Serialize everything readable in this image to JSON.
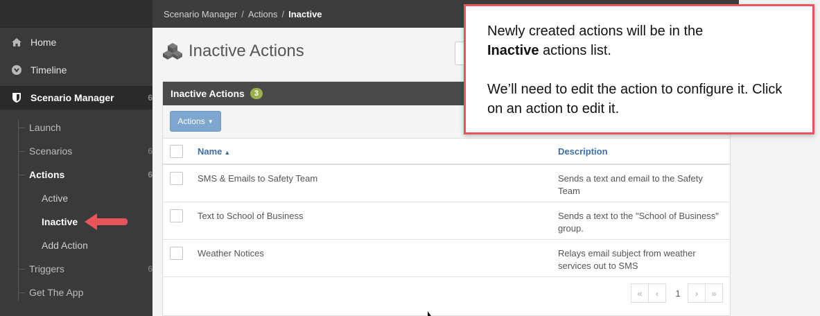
{
  "sidebar": {
    "items": [
      {
        "label": "Home",
        "icon": "home-icon"
      },
      {
        "label": "Timeline",
        "icon": "timeline-icon"
      },
      {
        "label": "Scenario Manager",
        "icon": "shield-icon",
        "trail": "6"
      }
    ],
    "sub_items": [
      {
        "label": "Launch"
      },
      {
        "label": "Scenarios",
        "trail": "6"
      },
      {
        "label": "Actions",
        "trail": "6"
      }
    ],
    "action_items": [
      {
        "label": "Active"
      },
      {
        "label": "Inactive"
      },
      {
        "label": "Add Action"
      }
    ],
    "more_items": [
      {
        "label": "Triggers",
        "trail": "6"
      },
      {
        "label": "Get The App"
      }
    ]
  },
  "breadcrumb": {
    "items": [
      "Scenario Manager",
      "Actions",
      "Inactive"
    ],
    "separator": "/"
  },
  "page": {
    "title": "Inactive Actions",
    "title_icon": "cubes-icon"
  },
  "panel": {
    "title": "Inactive Actions",
    "count": "3",
    "actions_button": "Actions",
    "columns": {
      "name": "Name",
      "description": "Description"
    },
    "rows": [
      {
        "name": "SMS & Emails to Safety Team",
        "description": "Sends a text and email to the Safety Team"
      },
      {
        "name": "Text to School of Business",
        "description": "Sends a text to the \"School of Business\" group."
      },
      {
        "name": "Weather Notices",
        "description": "Relays email subject from weather services out to SMS"
      }
    ]
  },
  "pagination": {
    "first": "«",
    "prev": "‹",
    "current": "1",
    "next": "›",
    "last": "»"
  },
  "callout": {
    "line1_a": "Newly created actions will be in the",
    "line2_bold": "Inactive",
    "line2_rest": " actions list.",
    "line3": "We’ll need to edit the action to configure it. Click on an action to edit it."
  },
  "colors": {
    "sidebar_bg": "#3a3a3a",
    "accent_blue": "#7ea6cf",
    "link_blue": "#3a6fa8",
    "badge_green": "#9bb04a",
    "callout_border": "#e8545a",
    "arrow_red": "#e8545a"
  }
}
